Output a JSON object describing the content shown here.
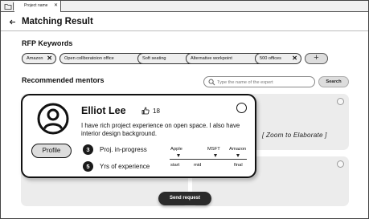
{
  "tabbar": {
    "tab_label": "Project name",
    "close_glyph": "✕"
  },
  "header": {
    "back_glyph": "←",
    "title": "Matching Result"
  },
  "rfp": {
    "title": "RFP Keywords",
    "keywords": [
      "Amazon",
      "Open collboratoion office",
      "Soft seating",
      "Alternative workpoint",
      "500 offices"
    ],
    "remove_glyph": "✕",
    "add_label": "+"
  },
  "mentors": {
    "title": "Recommended mentors",
    "search_placeholder": "Type the name of the expert",
    "search_button": "Search"
  },
  "card": {
    "name": "Elliot Lee",
    "likes": "18",
    "bio": "I have rich project experience on open space. I also have interior design background.",
    "profile_button": "Profile",
    "stats": [
      {
        "number": "3",
        "label": "Proj. in-progress"
      },
      {
        "number": "5",
        "label": "Yrs of experience"
      }
    ],
    "timeline": {
      "top_labels": [
        "Apple",
        "MSFT",
        "Amazon"
      ],
      "bottom_labels": [
        "start",
        "mid",
        "final"
      ]
    }
  },
  "zoom_text": "[ Zoom to Elaborate ]",
  "send_button": "Send request",
  "colors": {
    "primary_dark": "#2b2b2b",
    "chip_bg": "#eeeeee",
    "card_placeholder": "#ececec"
  }
}
